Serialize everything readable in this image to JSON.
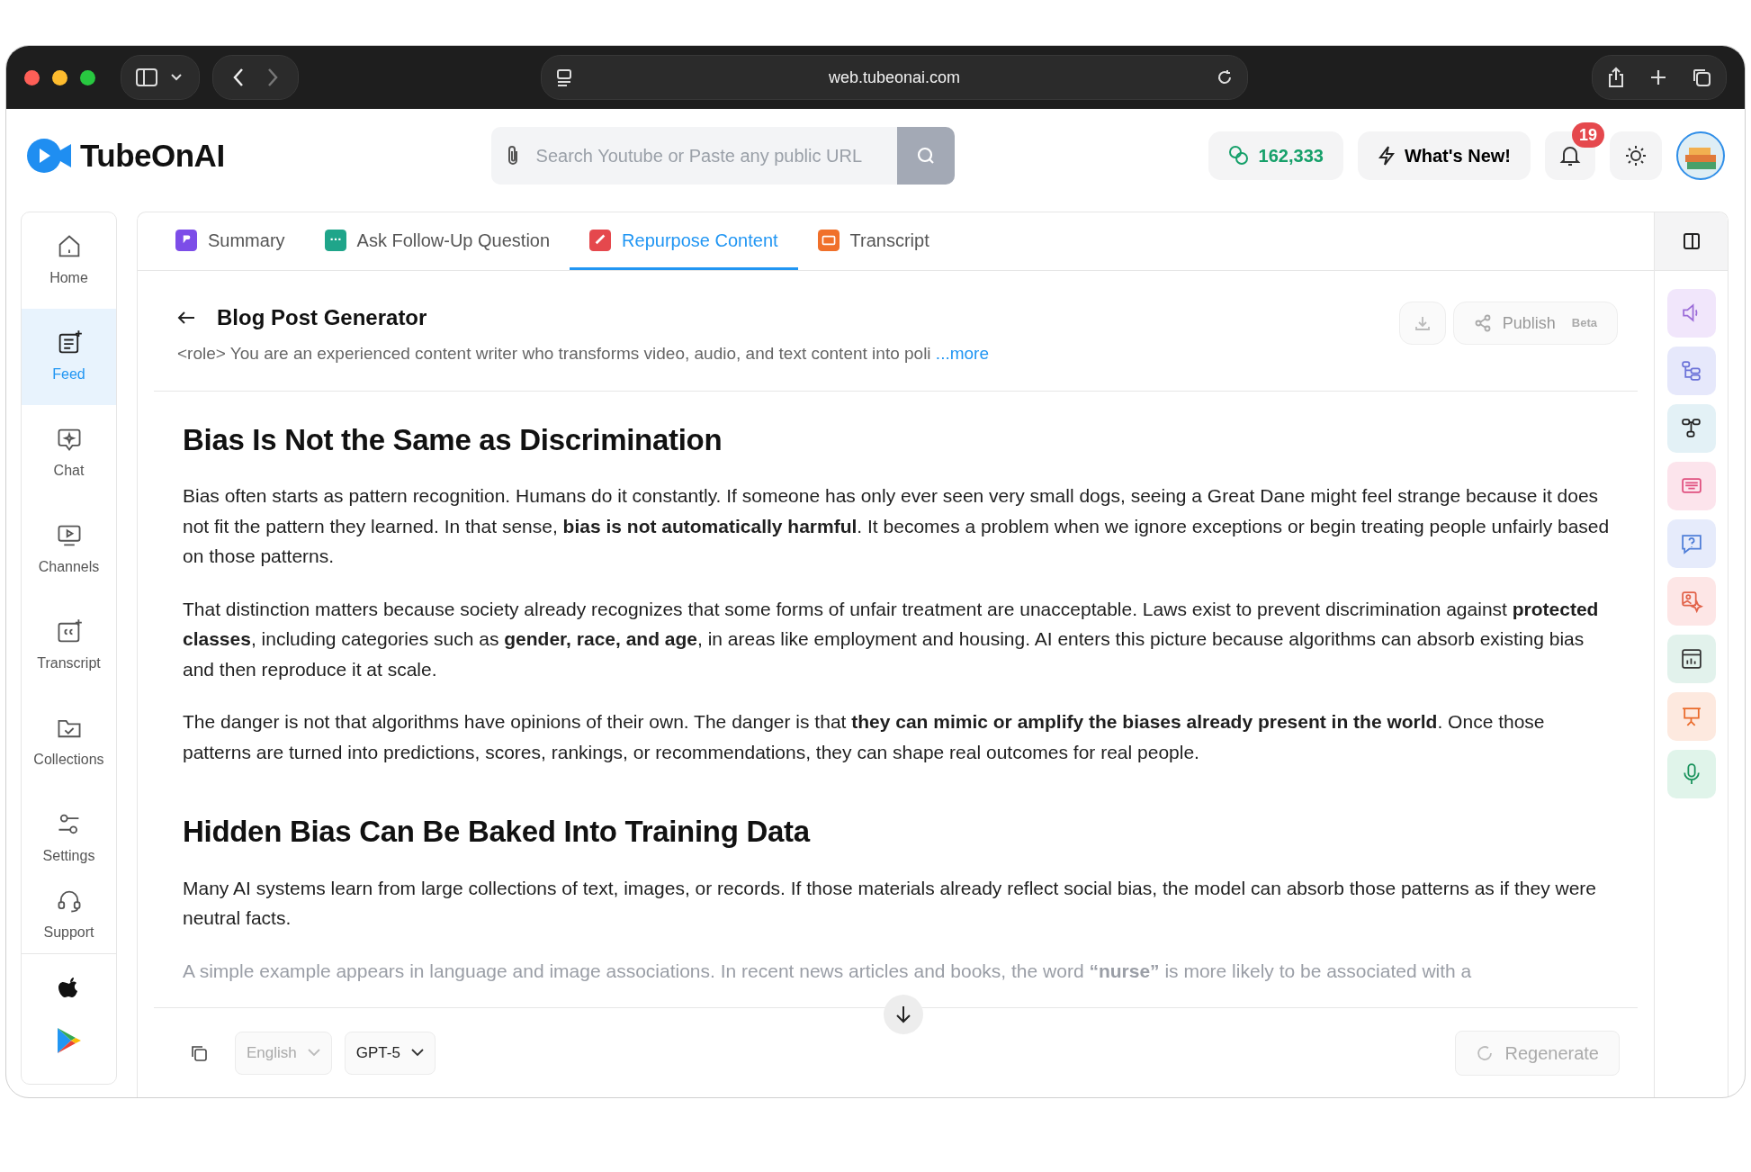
{
  "browser": {
    "url": "web.tubeonai.com"
  },
  "header": {
    "logo": "TubeOnAI",
    "search_placeholder": "Search Youtube or Paste any public URL",
    "credits": "162,333",
    "whats_new": "What's New!",
    "notifications": "19"
  },
  "sidebar": {
    "items": [
      {
        "label": "Home",
        "selected": false
      },
      {
        "label": "Feed",
        "selected": true
      },
      {
        "label": "Chat",
        "selected": false
      },
      {
        "label": "Channels",
        "selected": false
      },
      {
        "label": "Transcript",
        "selected": false
      },
      {
        "label": "Collections",
        "selected": false
      },
      {
        "label": "Settings",
        "selected": false
      },
      {
        "label": "Support",
        "selected": false
      }
    ]
  },
  "tabs": [
    {
      "label": "Summary",
      "selected": false,
      "color": "#7c4de8"
    },
    {
      "label": "Ask Follow-Up Question",
      "selected": false,
      "color": "#1fa58a"
    },
    {
      "label": "Repurpose Content",
      "selected": true,
      "color": "#e5484d"
    },
    {
      "label": "Transcript",
      "selected": false,
      "color": "#f0702a"
    }
  ],
  "panel": {
    "title": "Blog Post Generator",
    "prompt": "<role> You are an experienced content writer who transforms video, audio, and text content into poli",
    "more": "...more",
    "publish": "Publish",
    "beta": "Beta"
  },
  "article": [
    {
      "kind": "heading",
      "text": "Bias Is Not the Same as Discrimination"
    },
    {
      "kind": "paragraph",
      "text": "Bias often starts as pattern recognition. Humans do it constantly. If someone has only ever seen very small dogs, seeing a Great Dane might feel strange because it does not fit the pattern they learned. In that sense, **bias is not automatically harmful**. It becomes a problem when we ignore exceptions or begin treating people unfairly based on those patterns."
    },
    {
      "kind": "paragraph",
      "text": "That distinction matters because society already recognizes that some forms of unfair treatment are unacceptable. Laws exist to prevent discrimination against **protected classes**, including categories such as **gender, race, and age**, in areas like employment and housing. AI enters this picture because algorithms can absorb existing bias and then reproduce it at scale."
    },
    {
      "kind": "paragraph",
      "text": "The danger is not that algorithms have opinions of their own. The danger is that **they can mimic or amplify the biases already present in the world**. Once those patterns are turned into predictions, scores, rankings, or recommendations, they can shape real outcomes for real people."
    },
    {
      "kind": "heading",
      "text": "Hidden Bias Can Be Baked Into Training Data"
    },
    {
      "kind": "paragraph",
      "text": "Many AI systems learn from large collections of text, images, or records. If those materials already reflect social bias, the model can absorb those patterns as if they were neutral facts."
    },
    {
      "kind": "faded",
      "text": "A simple example appears in language and image associations. In recent news articles and books, the word **“nurse”** is more likely to be associated with a"
    }
  ],
  "footer": {
    "language": "English",
    "model": "GPT-5",
    "regenerate": "Regenerate"
  }
}
